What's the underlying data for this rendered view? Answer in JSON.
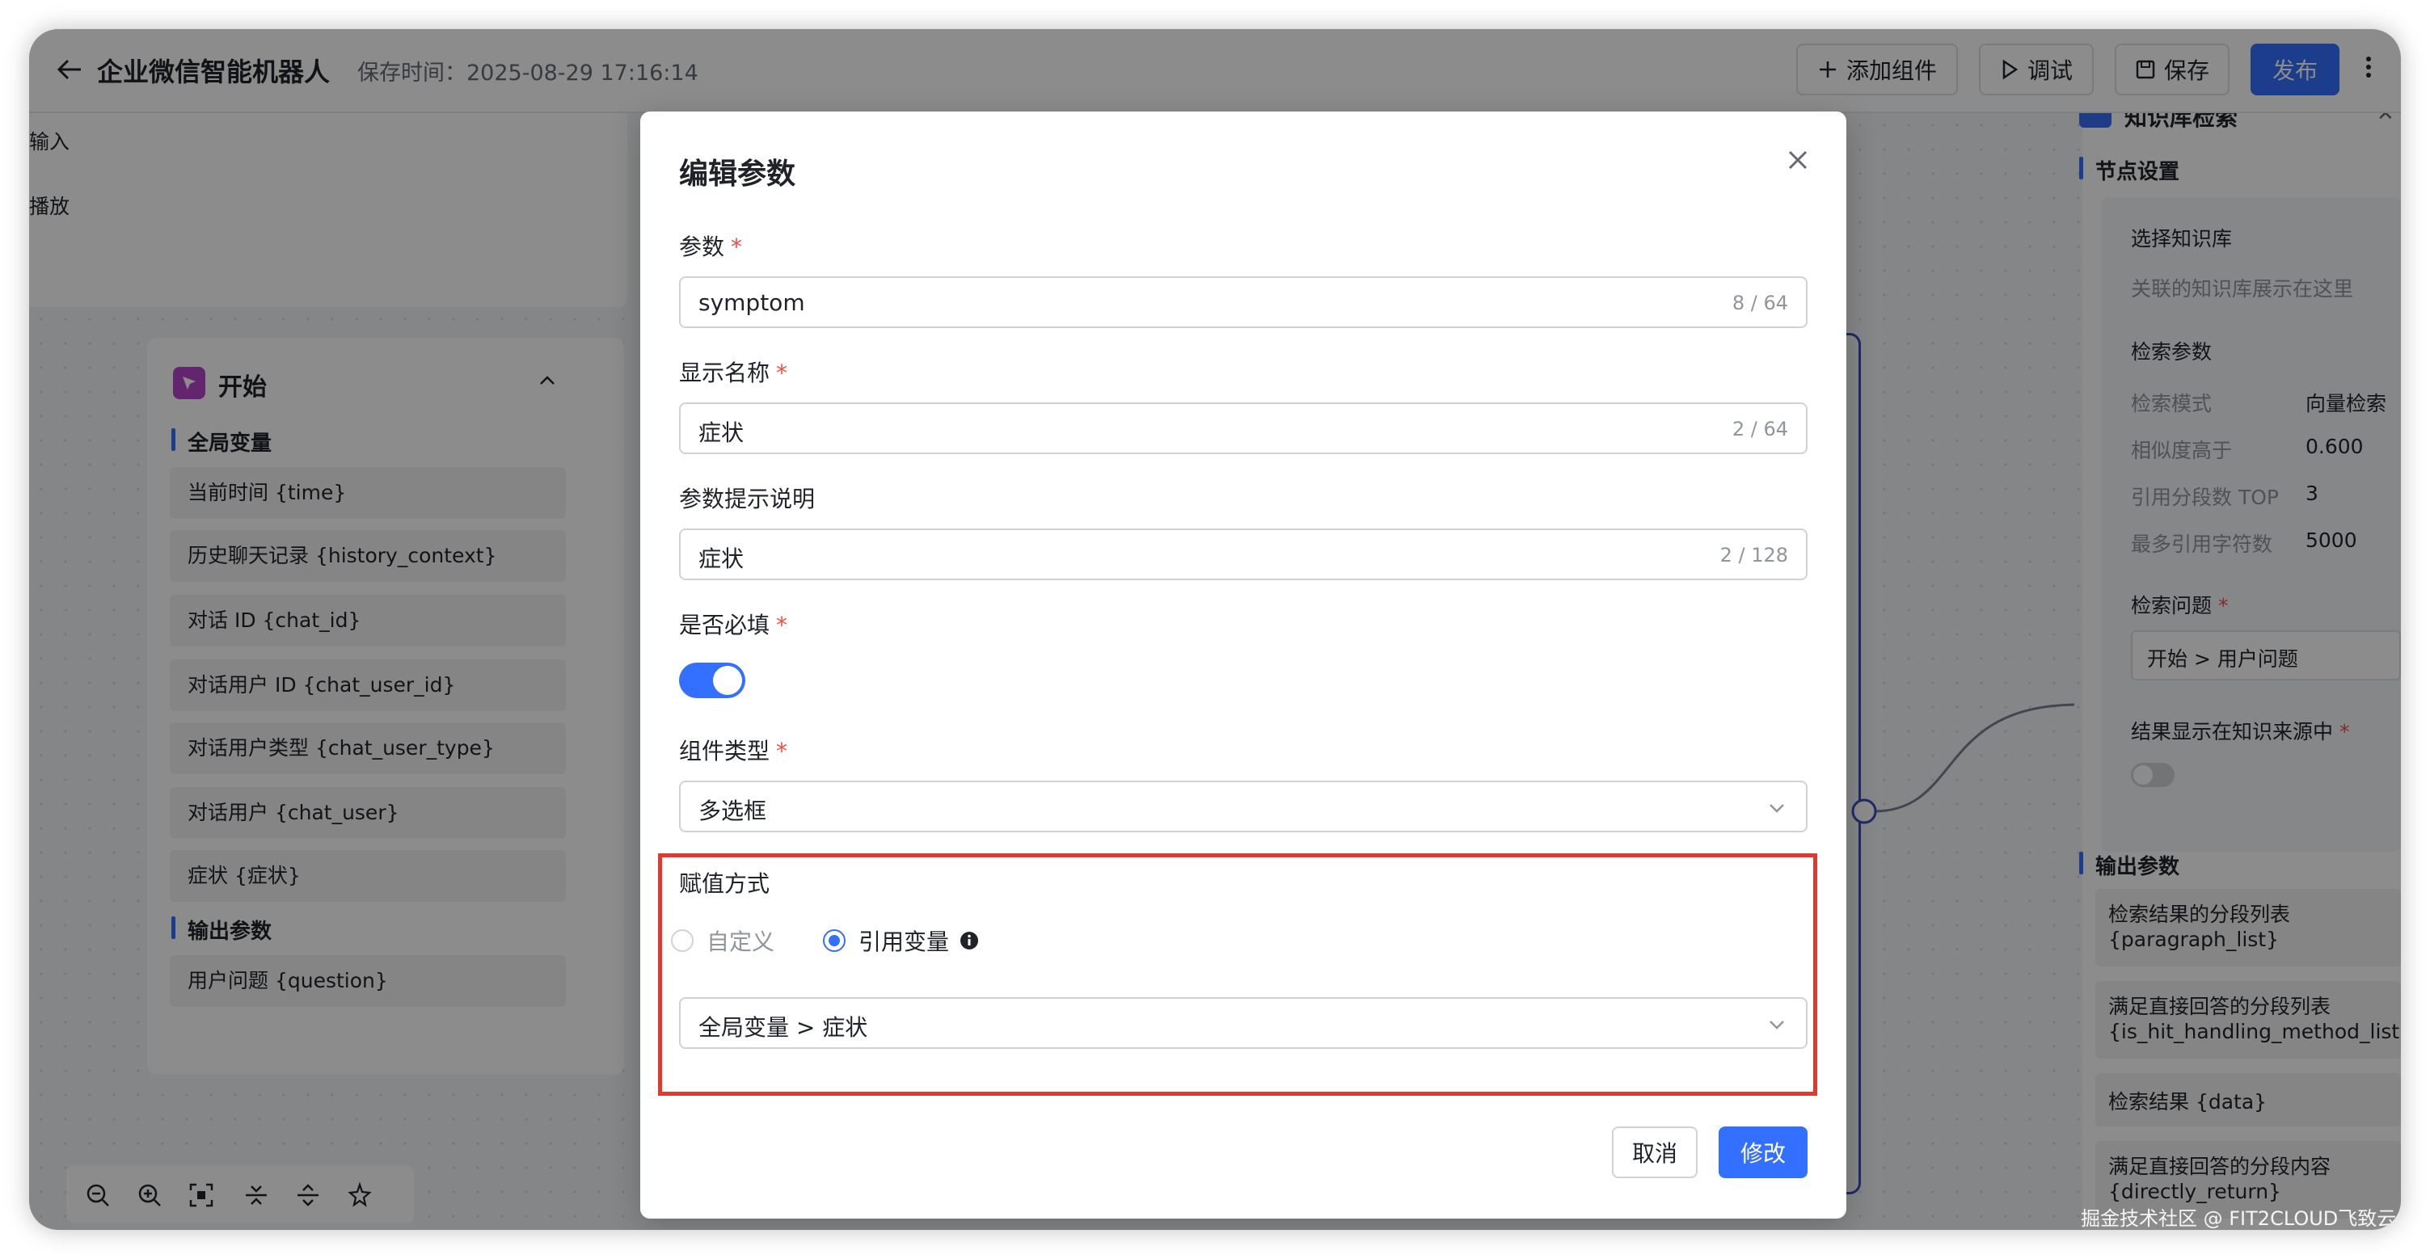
{
  "header": {
    "title": "企业微信智能机器人",
    "save_time": "保存时间：2025-08-29 17:16:14",
    "add_component": "添加组件",
    "debug": "调试",
    "save": "保存",
    "publish": "发布"
  },
  "left_top_card": {
    "line1": "输入",
    "line2": "播放"
  },
  "start_node": {
    "title": "开始",
    "global_vars_label": "全局变量",
    "global_vars": [
      "当前时间 {time}",
      "历史聊天记录 {history_context}",
      "对话 ID {chat_id}",
      "对话用户 ID {chat_user_id}",
      "对话用户类型 {chat_user_type}",
      "对话用户 {chat_user}",
      "症状 {症状}"
    ],
    "output_label": "输出参数",
    "outputs": [
      "用户问题 {question}"
    ]
  },
  "right_panel": {
    "title": "知识库检索",
    "node_settings": "节点设置",
    "select_kb": "选择知识库",
    "kb_placeholder": "关联的知识库展示在这里",
    "search_params": "检索参数",
    "params": [
      {
        "label": "检索模式",
        "value": "向量检索"
      },
      {
        "label": "相似度高于",
        "value": "0.600"
      },
      {
        "label": "引用分段数 TOP",
        "value": "3"
      },
      {
        "label": "最多引用字符数",
        "value": "5000"
      }
    ],
    "question_label": "检索问题",
    "question_value": "开始 > 用户问题",
    "show_in_source": "结果显示在知识来源中",
    "show_in_source_enabled": false,
    "output_label": "输出参数",
    "outputs": [
      {
        "line1": "检索结果的分段列表",
        "line2": "{paragraph_list}"
      },
      {
        "line1": "满足直接回答的分段列表",
        "line2": "{is_hit_handling_method_list}"
      },
      {
        "line1": "检索结果 {data}",
        "line2": ""
      },
      {
        "line1": "满足直接回答的分段内容",
        "line2": "{directly_return}"
      }
    ]
  },
  "dialog": {
    "title": "编辑参数",
    "param_label": "参数",
    "param_value": "symptom",
    "param_count": "8 / 64",
    "display_name_label": "显示名称",
    "display_name_value": "症状",
    "display_name_count": "2 / 64",
    "hint_label": "参数提示说明",
    "hint_value": "症状",
    "hint_count": "2 / 128",
    "required_label": "是否必填",
    "required_enabled": true,
    "component_type_label": "组件类型",
    "component_type_value": "多选框",
    "assign_label": "赋值方式",
    "assign_options": [
      "自定义",
      "引用变量"
    ],
    "assign_selected": "引用变量",
    "ref_var_value": "全局变量 > 症状",
    "cancel": "取消",
    "confirm": "修改"
  },
  "watermark": "掘金技术社区 @ FIT2CLOUD飞致云",
  "colors": {
    "primary": "#3370ff",
    "required": "#f54a45",
    "highlight_box": "#e03a2f",
    "start_icon": "#b545c8"
  }
}
